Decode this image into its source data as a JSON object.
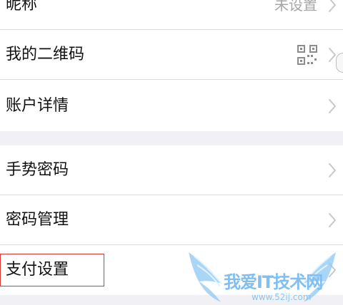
{
  "rows": [
    {
      "label": "昵称",
      "value": "未设置"
    },
    {
      "label": "我的二维码",
      "value": ""
    },
    {
      "label": "账户详情",
      "value": ""
    },
    {
      "label": "手势密码",
      "value": ""
    },
    {
      "label": "密码管理",
      "value": ""
    },
    {
      "label": "支付设置",
      "value": ""
    }
  ],
  "icons": {
    "chevron": "chevron-right-icon",
    "qr": "qr-code-icon",
    "side_handle": "side-handle-icon"
  },
  "colors": {
    "background": "#f0f0f5",
    "card": "#ffffff",
    "text": "#111111",
    "muted": "#a6a6a6",
    "divider": "#d9d9d9",
    "highlight": "#d83a3a",
    "watermark": "#73b9ef"
  },
  "watermark": {
    "title": "我爱IT技术网",
    "url": "www.52ij.com"
  }
}
